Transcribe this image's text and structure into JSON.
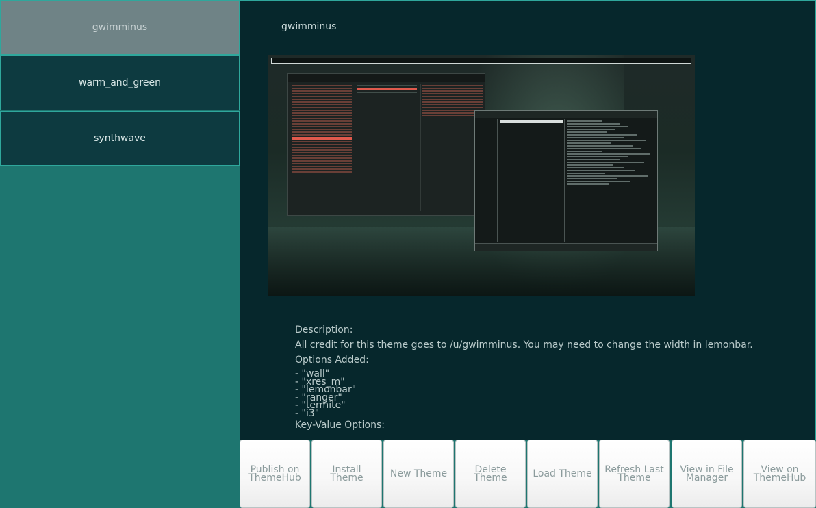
{
  "sidebar": {
    "items": [
      {
        "label": "gwimminus",
        "active": true
      },
      {
        "label": "warm_and_green",
        "active": false
      },
      {
        "label": "synthwave",
        "active": false
      }
    ]
  },
  "main": {
    "title": "gwimminus",
    "description_heading": "Description:",
    "description_text": "All credit for this theme goes to /u/gwimminus. You may need to change the width in lemonbar.",
    "options_heading": "Options Added:",
    "options": [
      "- \"wall\"",
      "- \"xres_m\"",
      "- \"lemonbar\"",
      "- \"ranger\"",
      "- \"termite\"",
      "- \"i3\""
    ],
    "kv_heading": "Key-Value Options:"
  },
  "toolbar": {
    "buttons": [
      "Publish on ThemeHub",
      "Install Theme",
      "New Theme",
      "Delete Theme",
      "Load Theme",
      "Refresh Last Theme",
      "View in File Manager",
      "View on ThemeHub"
    ]
  },
  "colors": {
    "sidebar_bg": "#1e7670",
    "main_bg": "#06272c",
    "active_item": "#6f8386",
    "border_accent": "#2fa79c"
  }
}
